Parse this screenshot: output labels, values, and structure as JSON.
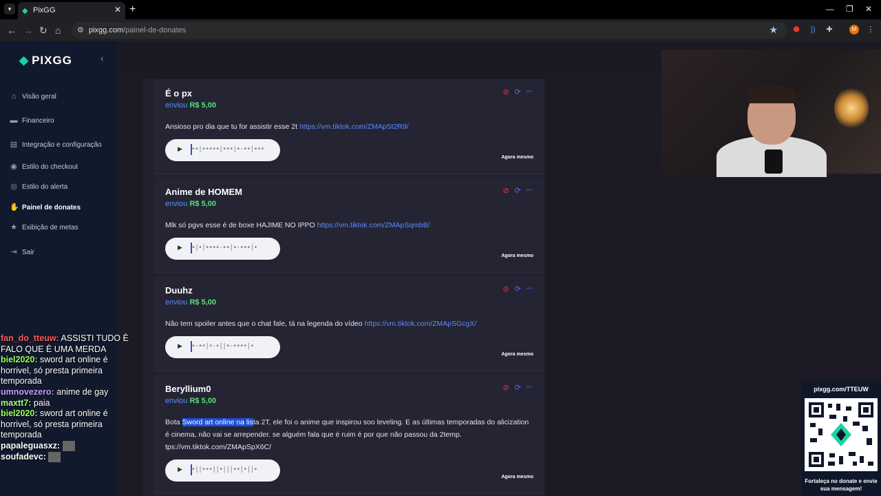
{
  "browser": {
    "tab_title": "PixGG",
    "tab_close": "✕",
    "new_tab": "+",
    "url_domain": "pixgg.com",
    "url_path": "/painel-de-donates",
    "avatar_letter": "M"
  },
  "sidebar": {
    "logo": "PIXGG",
    "items": [
      {
        "label": "Visão geral",
        "icon": "home-icon"
      },
      {
        "label": "Financeiro",
        "icon": "wallet-icon"
      },
      {
        "label": "Integração e configuração",
        "icon": "settings-icon"
      },
      {
        "label": "Estilo do checkout",
        "icon": "palette-icon"
      },
      {
        "label": "Estilo do alerta",
        "icon": "palette-icon"
      },
      {
        "label": "Painel de donates",
        "icon": "hand-icon"
      },
      {
        "label": "Exibição de metas",
        "icon": "star-icon"
      },
      {
        "label": "Sair",
        "icon": "logout-icon"
      }
    ]
  },
  "donations": [
    {
      "name": "É o px",
      "sent": "enviou",
      "amount": "R$ 5,00",
      "message": "Ansioso pro dia que tu for assistir esse 2t ",
      "link": "https://vm.tiktok.com/ZMApSt2R9/",
      "waveform": "••|•••••|•••|•-••|•••",
      "time": "Agora mesmo"
    },
    {
      "name": "Anime de HOMEM",
      "sent": "enviou",
      "amount": "R$ 5,00",
      "message": "Mlk só pgvs esse é de boxe HAJIME NO IPPO ",
      "link": "https://vm.tiktok.com/ZMApSqmbB/",
      "waveform": "•|•|••••-••|•-•••|•",
      "time": "Agora mesmo"
    },
    {
      "name": "Duuhz",
      "sent": "enviou",
      "amount": "R$ 5,00",
      "message": "Não tem spoiler antes que o chat fale, tá na legenda do vídeo ",
      "link": "https://vm.tiktok.com/ZMApSGcgX/",
      "waveform": "•-••|•-•||•-••••|•",
      "time": "Agora mesmo"
    },
    {
      "name": "Beryllium0",
      "sent": "enviou",
      "amount": "R$ 5,00",
      "message_before": "Bota ",
      "message_highlight": "Sword art online na lis",
      "message_after": "ta 2T, ele foi o anime que inspirou soo leveling. E as últimas temporadas do alicization é cinema, não vai se arrepender. se alguém fala que é ruim é por que não passou da 2temp.",
      "message_link_line": "tps://vm.tiktok.com/ZMApSpX6C/",
      "waveform": "•||•••||•|||••|•||•",
      "time": "Agora mesmo"
    }
  ],
  "chat": [
    {
      "user": "fan_do_tteuw:",
      "text": " ASSISTI TUDO È FALO QUE È UMA MERDA",
      "cls": "u1"
    },
    {
      "user": "biel2020:",
      "text": " sword art online é horrivel, só presta primeira temporada",
      "cls": "u2"
    },
    {
      "user": "umnovezero:",
      "text": " anime de gay",
      "cls": "u3"
    },
    {
      "user": "maxtt7:",
      "text": " paia",
      "cls": "u4"
    },
    {
      "user": "biel2020:",
      "text": " sword art online é horrivel, só presta primeira temporada",
      "cls": "u2"
    },
    {
      "user": "papaleguasxz:",
      "text": "",
      "cls": "u5"
    },
    {
      "user": "soufadevc:",
      "text": "",
      "cls": "u5"
    }
  ],
  "qr": {
    "title": "pixgg.com/TTEUW",
    "caption": "Fortaleça no donate e envie sua mensagem!"
  },
  "colors": {
    "sidebar_bg": "#11192d",
    "accent": "#19d3a2",
    "link": "#5b8cff",
    "money": "#57e07a",
    "ban": "#e53935"
  }
}
